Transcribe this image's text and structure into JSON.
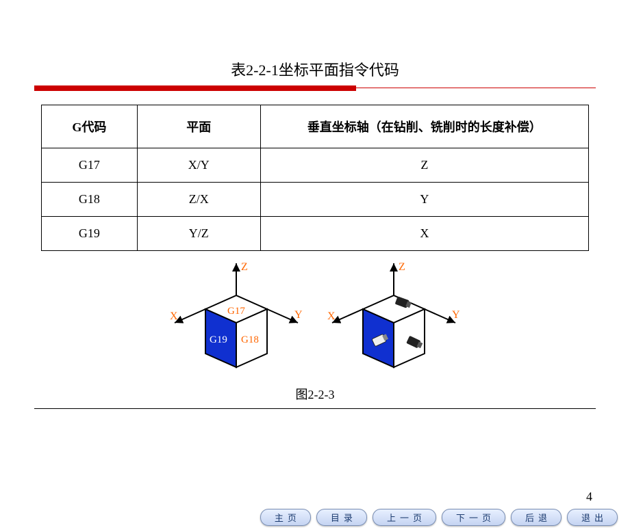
{
  "title": "表2-2-1坐标平面指令代码",
  "table": {
    "headers": [
      "G代码",
      "平面",
      "垂直坐标轴（在钻削、铣削时的长度补偿）"
    ],
    "rows": [
      [
        "G17",
        "X/Y",
        "Z"
      ],
      [
        "G18",
        "Z/X",
        "Y"
      ],
      [
        "G19",
        "Y/Z",
        "X"
      ]
    ]
  },
  "diagram": {
    "axes": {
      "x": "X",
      "y": "Y",
      "z": "Z"
    },
    "faces": {
      "top": "G17",
      "left": "G19",
      "right": "G18"
    }
  },
  "figure_caption": "图2-2-3",
  "page_number": "4",
  "nav": {
    "home": "主页",
    "toc": "目录",
    "prev": "上一页",
    "next": "下一页",
    "back": "后退",
    "exit": "退出"
  },
  "colors": {
    "accent_red": "#cc0000",
    "axis_orange": "#ff6600",
    "face_blue": "#1030d0",
    "nav_bg": "#c5d4f2"
  }
}
